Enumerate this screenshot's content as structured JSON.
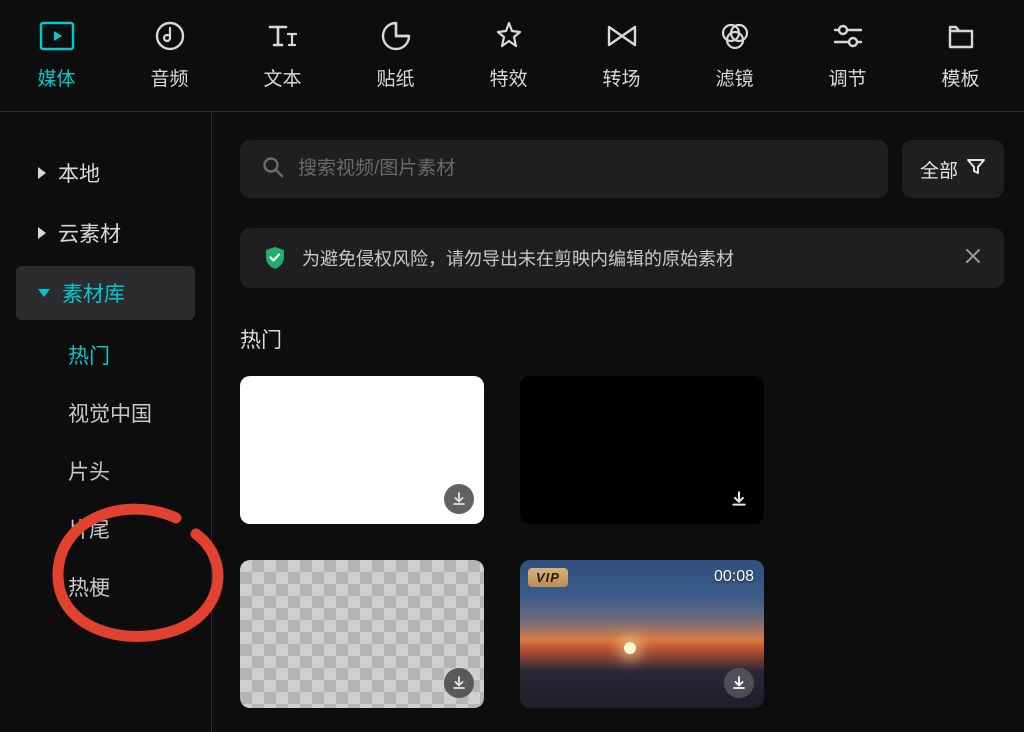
{
  "top_nav": [
    {
      "id": "media",
      "label": "媒体",
      "active": true
    },
    {
      "id": "audio",
      "label": "音频",
      "active": false
    },
    {
      "id": "text",
      "label": "文本",
      "active": false
    },
    {
      "id": "sticker",
      "label": "贴纸",
      "active": false
    },
    {
      "id": "effect",
      "label": "特效",
      "active": false
    },
    {
      "id": "transition",
      "label": "转场",
      "active": false
    },
    {
      "id": "filter",
      "label": "滤镜",
      "active": false
    },
    {
      "id": "adjust",
      "label": "调节",
      "active": false
    },
    {
      "id": "template",
      "label": "模板",
      "active": false
    }
  ],
  "sidebar": {
    "groups": [
      {
        "id": "local",
        "label": "本地",
        "expanded": false,
        "active": false
      },
      {
        "id": "cloud",
        "label": "云素材",
        "expanded": false,
        "active": false
      },
      {
        "id": "library",
        "label": "素材库",
        "expanded": true,
        "active": true
      }
    ],
    "sub_items": [
      {
        "id": "hot",
        "label": "热门",
        "active": true
      },
      {
        "id": "vcg",
        "label": "视觉中国",
        "active": false
      },
      {
        "id": "intro",
        "label": "片头",
        "active": false
      },
      {
        "id": "outro",
        "label": "片尾",
        "active": false
      },
      {
        "id": "meme",
        "label": "热梗",
        "active": false
      }
    ]
  },
  "search": {
    "placeholder": "搜索视频/图片素材"
  },
  "filter_button": "全部",
  "notice": {
    "text": "为避免侵权风险，请勿导出未在剪映内编辑的原始素材"
  },
  "section_title": "热门",
  "thumbs": {
    "vip_label": "VIP",
    "duration_4": "00:08"
  },
  "colors": {
    "accent": "#00c8cf",
    "bg": "#0d0d0d",
    "panel": "#1f1f21"
  }
}
